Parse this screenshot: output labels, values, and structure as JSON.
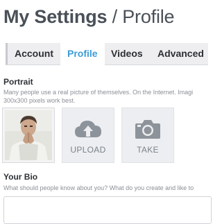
{
  "header": {
    "title_main": "My Settings",
    "title_separator": " / ",
    "title_sub": "Profile"
  },
  "tabs": [
    {
      "label": "Account",
      "active": false
    },
    {
      "label": "Profile",
      "active": true
    },
    {
      "label": "Videos",
      "active": false
    },
    {
      "label": "Advanced",
      "active": false
    }
  ],
  "portrait": {
    "label": "Portrait",
    "help_line1": "Many people use a real picture of themselves. On the Internet. Imagi",
    "help_line2": "300x300 pixels work best.",
    "upload_label": "UPLOAD",
    "take_label": "TAKE",
    "upload_icon": "cloud-upload-icon",
    "take_icon": "camera-icon"
  },
  "bio": {
    "label": "Your Bio",
    "help": "What should people know about you? What do you create and like to"
  },
  "colors": {
    "accent": "#3d9bd6",
    "tab_bar": "#eeeef1",
    "tile_bg": "#eceef1",
    "icon_gray": "#8d939a"
  }
}
